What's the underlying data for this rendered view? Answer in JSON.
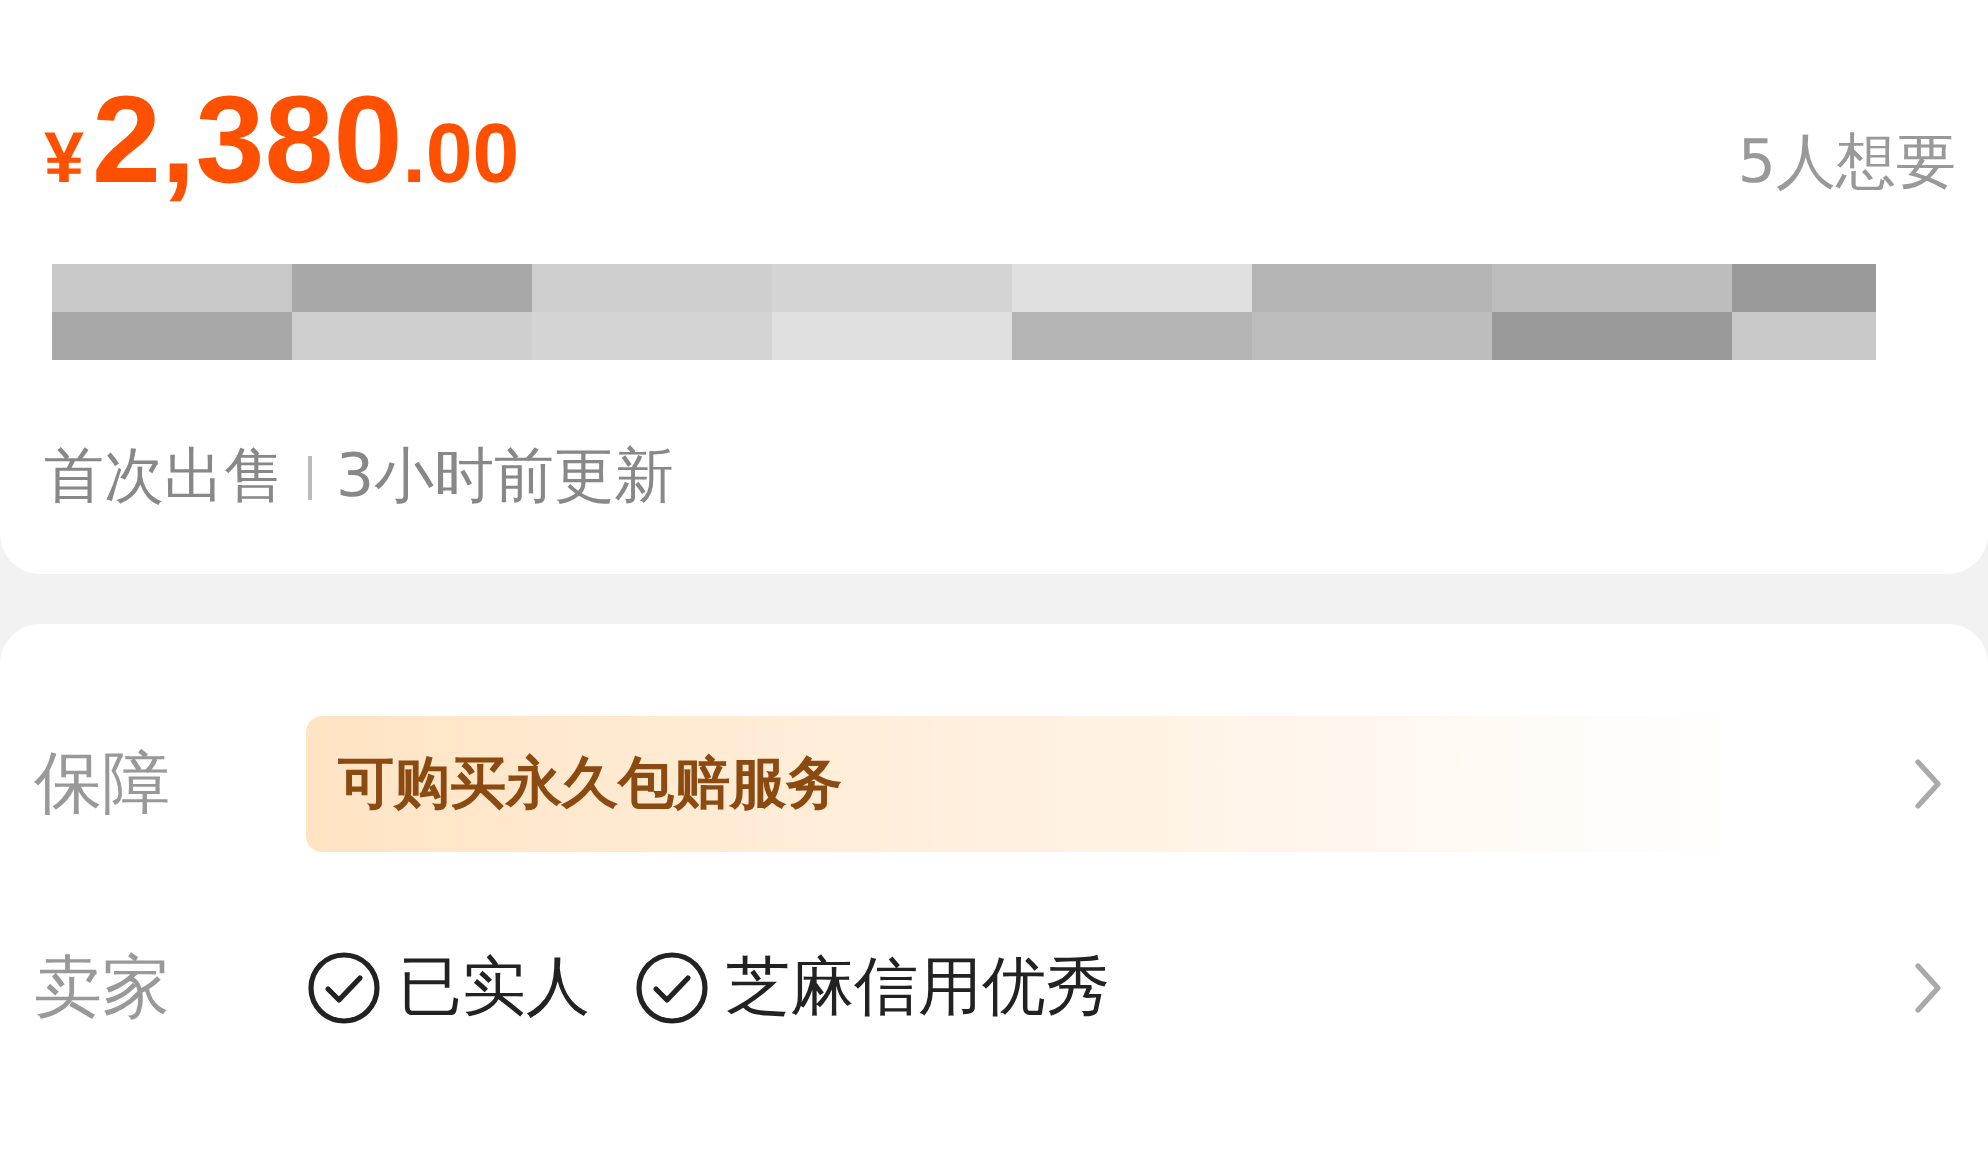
{
  "price": {
    "currency": "¥",
    "integer": "2,380",
    "decimal": ".00"
  },
  "wants": "5人想要",
  "meta": [
    "首次出售",
    "3小时前更新"
  ],
  "rows": [
    {
      "kind": "banner",
      "label": "保障",
      "text": "可购买永久包赔服务"
    },
    {
      "kind": "badges",
      "label": "卖家",
      "badges": [
        "已实人",
        "芝麻信用优秀"
      ]
    }
  ]
}
